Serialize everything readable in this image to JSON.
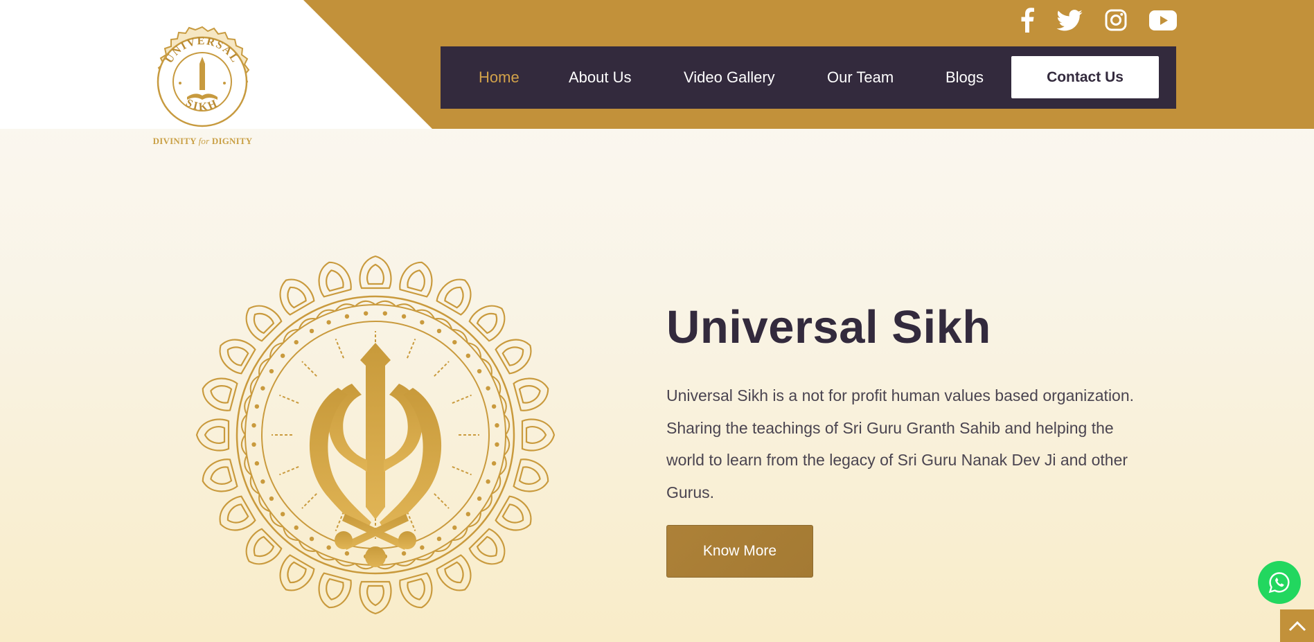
{
  "brand": {
    "logo_top_text": "UNIVERSAL",
    "logo_bottom_text": "SIKH",
    "tagline_left": "DIVINITY ",
    "tagline_mid": "for",
    "tagline_right": " DIGNITY"
  },
  "social": [
    {
      "name": "facebook-icon"
    },
    {
      "name": "twitter-icon"
    },
    {
      "name": "instagram-icon"
    },
    {
      "name": "youtube-icon"
    }
  ],
  "nav": {
    "items": [
      {
        "label": "Home",
        "active": true
      },
      {
        "label": "About Us"
      },
      {
        "label": "Video Gallery"
      },
      {
        "label": "Our Team"
      },
      {
        "label": "Blogs"
      }
    ],
    "contact_label": "Contact Us"
  },
  "hero": {
    "title": "Universal Sikh",
    "description": "Universal Sikh is a not for profit human values based organization. Sharing the teachings of Sri Guru Granth Sahib and helping the world to learn from the legacy of Sri Guru Nanak Dev Ji and other Gurus.",
    "button_label": "Know More"
  },
  "colors": {
    "gold": "#c2913a",
    "nav_bg": "#332a3d",
    "active_link": "#d2a24a",
    "whatsapp": "#22d75f"
  }
}
